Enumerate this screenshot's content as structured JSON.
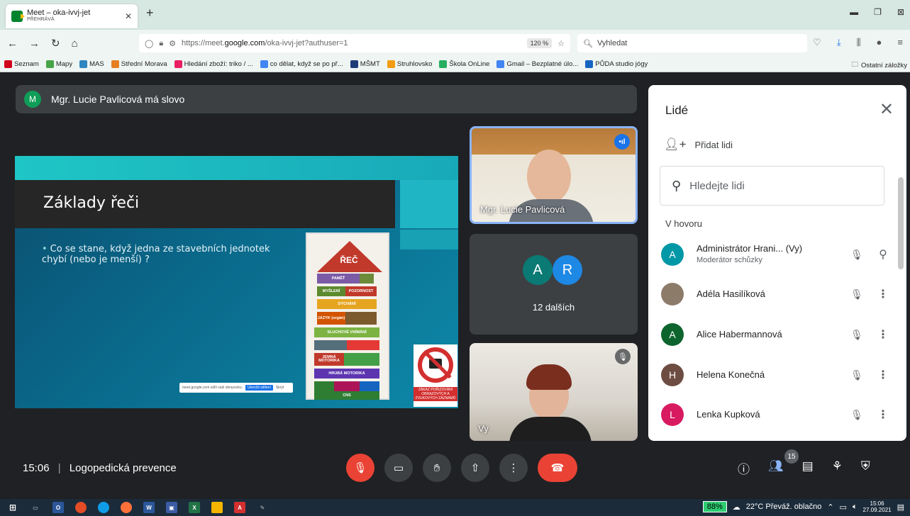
{
  "browser": {
    "tab_title": "Meet – oka-ivvj-jet",
    "tab_subtitle": "PŘEHRÁVÁ",
    "url_prefix": "https://meet.",
    "url_domain": "google.com",
    "url_path": "/oka-ivvj-jet?authuser=1",
    "zoom": "120 %",
    "search_placeholder": "Vyhledat",
    "bookmarks": [
      {
        "label": "Seznam",
        "color": "#d0021b"
      },
      {
        "label": "Mapy",
        "color": "#47a447"
      },
      {
        "label": "MAS",
        "color": "#2e86c1"
      },
      {
        "label": "Střední Morava",
        "color": "#e67e22"
      },
      {
        "label": "Hledání zboží: triko / ...",
        "color": "#e91e63"
      },
      {
        "label": "co dělat, když se po př...",
        "color": "#4285f4"
      },
      {
        "label": "MŠMT",
        "color": "#1d3c78"
      },
      {
        "label": "Struhlovsko",
        "color": "#f39c12"
      },
      {
        "label": "Škola OnLine",
        "color": "#27ae60"
      },
      {
        "label": "Gmail – Bezplatné úlo...",
        "color": "#4285f4"
      },
      {
        "label": "PŮDA studio jógy",
        "color": "#1565c0"
      }
    ],
    "other_bookmarks": "Ostatní záložky"
  },
  "meet": {
    "speaker_initial": "M",
    "speaker_banner": "Mgr. Lucie Pavlicová má slovo",
    "slide": {
      "title": "Základy řeči",
      "bullet": "Co se stane, když jedna ze stavebních jednotek chybí (nebo je menší) ?",
      "tower_top": "ŘEČ",
      "tower_blocks": [
        "PAMĚŤ",
        "MYŠLENÍ",
        "POZORNOST",
        "DÝCHÁNÍ",
        "JAZYK (orgán)",
        "SLUCHOVÉ VNÍMÁNÍ",
        "JEMNÁ MOTORIKA",
        "HRUBÁ MOTORIKA",
        "CNS"
      ],
      "no_photo_text": "ZÁKAZ POŘIZOVÁNÍ OBRAZOVÝCH A ZVUKOVÝCH ZÁZNAMŮ",
      "share_bar_text": "meet.google.com sdílí vaši obrazovku.",
      "share_bar_btn": "Ukončit sdílení",
      "share_bar_hide": "Skrýt"
    },
    "tiles": {
      "speaker_name": "Mgr. Lucie Pavlicová",
      "others": [
        {
          "initial": "A",
          "color": "#0b7a75"
        },
        {
          "initial": "R",
          "color": "#1e88e5"
        }
      ],
      "others_label": "12 dalších",
      "self_name": "Vy"
    },
    "panel": {
      "title": "Lidé",
      "add_people": "Přidat lidi",
      "search_placeholder": "Hledejte lidi",
      "in_call": "V hovoru",
      "people": [
        {
          "initial": "A",
          "name": "Administrátor Hrani...  (Vy)",
          "role": "Moderátor schůzky",
          "color": "#0097a7"
        },
        {
          "initial": "",
          "name": "Adéla Hasilíková",
          "role": "",
          "color": "#8d7b6a"
        },
        {
          "initial": "A",
          "name": "Alice Habermannová",
          "role": "",
          "color": "#0d652d"
        },
        {
          "initial": "H",
          "name": "Helena Konečná",
          "role": "",
          "color": "#6d4c41"
        },
        {
          "initial": "L",
          "name": "Lenka Kupková",
          "role": "",
          "color": "#d81b60"
        }
      ]
    },
    "bottom": {
      "time": "15:06",
      "meeting_name": "Logopedická prevence",
      "participants_count": "15"
    }
  },
  "taskbar": {
    "battery": "88%",
    "weather": "22°C  Převáž. oblačno",
    "time": "15:06",
    "date": "27.09.2021"
  }
}
